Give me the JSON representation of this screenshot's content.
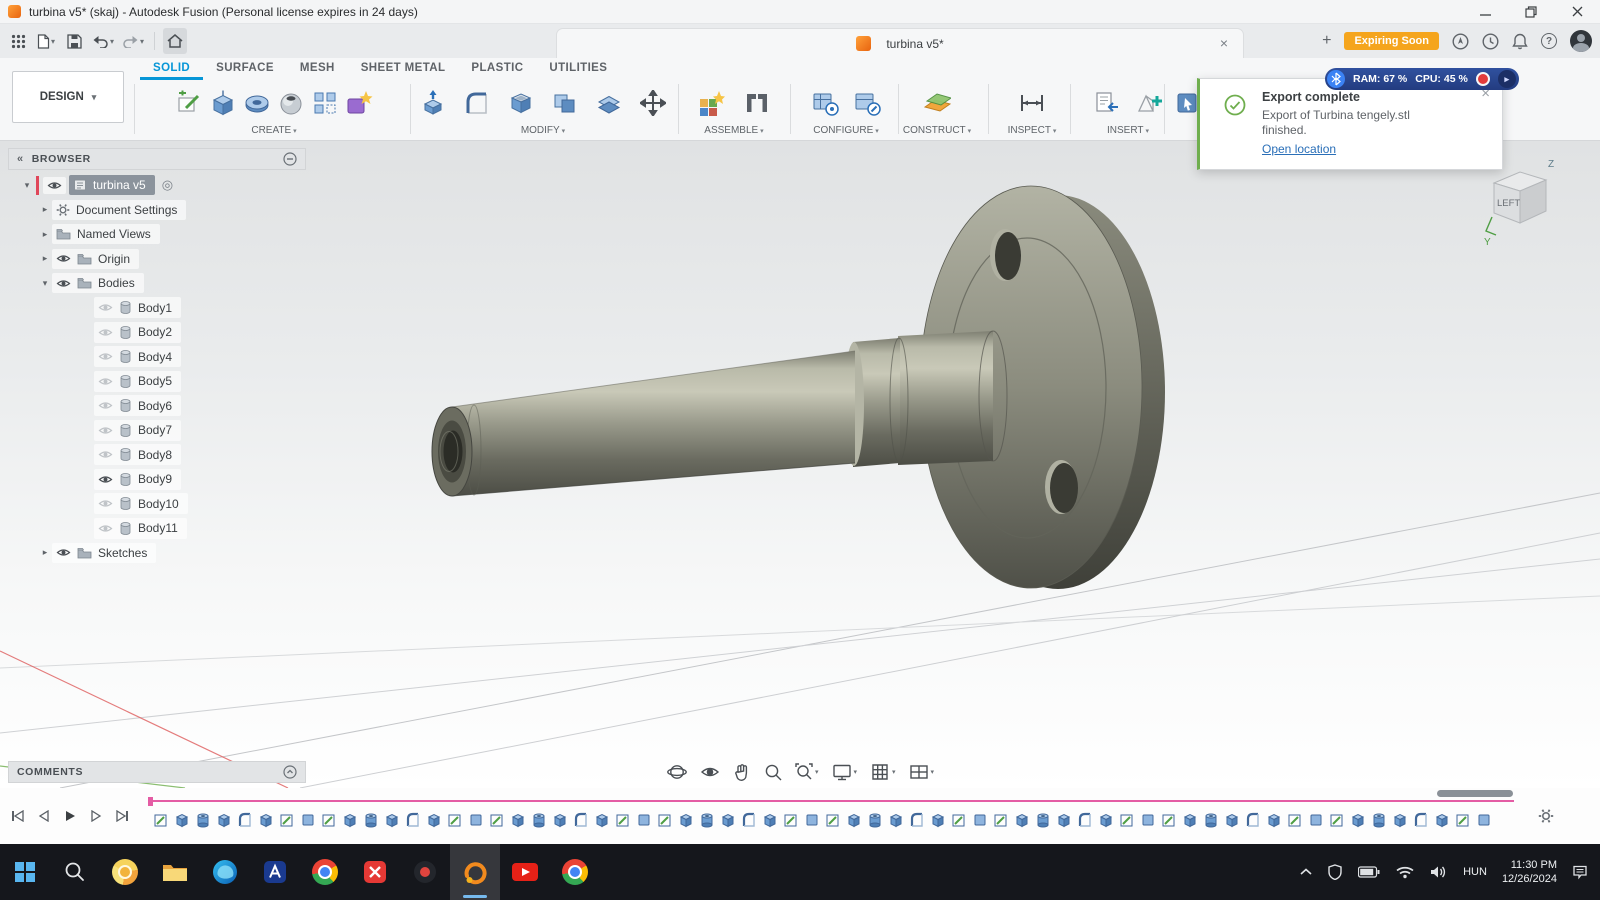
{
  "title_bar": {
    "title": "turbina v5* (skaj) - Autodesk Fusion (Personal license expires in 24 days)"
  },
  "tabstrip": {
    "doc_tab": "turbina v5*",
    "expiring_badge": "Expiring Soon"
  },
  "ribbon": {
    "design_label": "DESIGN",
    "tabs": [
      {
        "label": "SOLID",
        "active": true
      },
      {
        "label": "SURFACE"
      },
      {
        "label": "MESH"
      },
      {
        "label": "SHEET METAL"
      },
      {
        "label": "PLASTIC"
      },
      {
        "label": "UTILITIES"
      }
    ],
    "groups": {
      "create": "CREATE",
      "modify": "MODIFY",
      "assemble": "ASSEMBLE",
      "configure": "CONFIGURE",
      "construct": "CONSTRUCT",
      "inspect": "INSPECT",
      "insert": "INSERT"
    }
  },
  "browser": {
    "header": "BROWSER",
    "rows": [
      {
        "label": "turbina v5",
        "level": 0,
        "expander": "open",
        "eye": "on",
        "icon": "root",
        "selected": true
      },
      {
        "label": "Document Settings",
        "level": 1,
        "expander": "closed",
        "eye": "none",
        "icon": "gear"
      },
      {
        "label": "Named Views",
        "level": 1,
        "expander": "closed",
        "eye": "none",
        "icon": "folder"
      },
      {
        "label": "Origin",
        "level": 1,
        "expander": "closed",
        "eye": "on",
        "icon": "folder"
      },
      {
        "label": "Bodies",
        "level": 1,
        "expander": "open",
        "eye": "on",
        "icon": "folder"
      },
      {
        "label": "Body1",
        "level": 2,
        "expander": "none",
        "eye": "off",
        "icon": "body"
      },
      {
        "label": "Body2",
        "level": 2,
        "expander": "none",
        "eye": "off",
        "icon": "body"
      },
      {
        "label": "Body4",
        "level": 2,
        "expander": "none",
        "eye": "off",
        "icon": "body"
      },
      {
        "label": "Body5",
        "level": 2,
        "expander": "none",
        "eye": "off",
        "icon": "body"
      },
      {
        "label": "Body6",
        "level": 2,
        "expander": "none",
        "eye": "off",
        "icon": "body"
      },
      {
        "label": "Body7",
        "level": 2,
        "expander": "none",
        "eye": "off",
        "icon": "body"
      },
      {
        "label": "Body8",
        "level": 2,
        "expander": "none",
        "eye": "off",
        "icon": "body"
      },
      {
        "label": "Body9",
        "level": 2,
        "expander": "none",
        "eye": "on",
        "icon": "body"
      },
      {
        "label": "Body10",
        "level": 2,
        "expander": "none",
        "eye": "off",
        "icon": "body"
      },
      {
        "label": "Body11",
        "level": 2,
        "expander": "none",
        "eye": "off",
        "icon": "body"
      },
      {
        "label": "Sketches",
        "level": 1,
        "expander": "closed",
        "eye": "on",
        "icon": "folder"
      }
    ]
  },
  "toast": {
    "title": "Export complete",
    "body": "Export of Turbina tengely.stl finished.",
    "link": "Open location"
  },
  "perf": {
    "ram": "RAM: 67 %",
    "cpu": "CPU: 45 %"
  },
  "viewcube": {
    "face": "LEFT",
    "axis_z": "Z",
    "axis_y": "Y"
  },
  "comments": {
    "label": "COMMENTS"
  },
  "timeline": {
    "features": [
      "sketch",
      "extrude",
      "hole",
      "extrude",
      "fillet",
      "extrude",
      "sketch",
      "box",
      "sketch",
      "extrude",
      "hole",
      "extrude",
      "fillet",
      "extrude",
      "sketch",
      "box",
      "sketch",
      "extrude",
      "hole",
      "extrude",
      "fillet",
      "extrude",
      "sketch",
      "box",
      "sketch",
      "extrude",
      "hole",
      "extrude",
      "fillet",
      "extrude",
      "sketch",
      "box",
      "sketch",
      "extrude",
      "hole",
      "extrude",
      "fillet",
      "extrude",
      "sketch",
      "box",
      "sketch",
      "extrude",
      "hole",
      "extrude",
      "fillet",
      "extrude",
      "sketch",
      "box",
      "sketch",
      "extrude",
      "hole",
      "extrude",
      "fillet",
      "extrude",
      "sketch",
      "box",
      "sketch",
      "extrude",
      "hole",
      "extrude",
      "fillet",
      "extrude",
      "sketch",
      "box"
    ]
  },
  "taskbar": {
    "lang": "HUN",
    "time": "11:30 PM",
    "date": "12/26/2024"
  }
}
